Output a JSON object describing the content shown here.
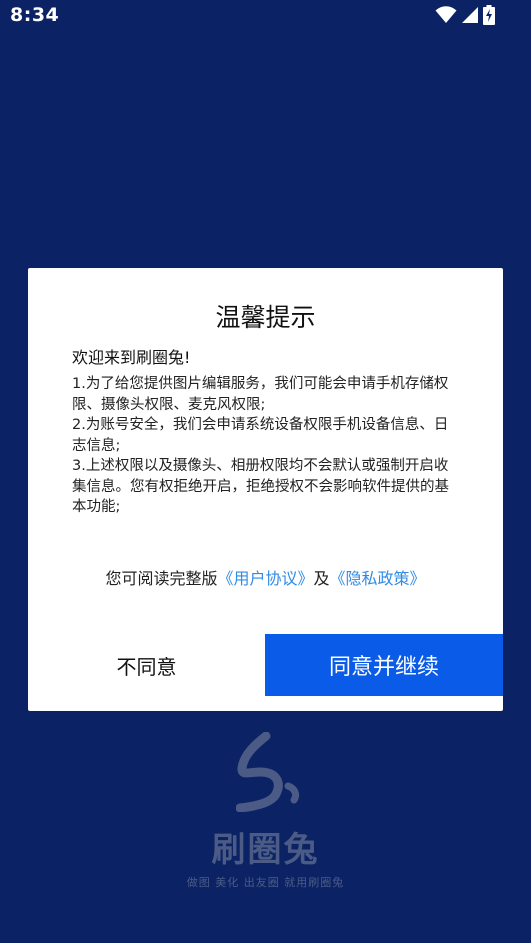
{
  "status_bar": {
    "time": "8:34",
    "icons": [
      "wifi-icon",
      "signal-icon",
      "battery-charging-icon"
    ]
  },
  "dialog": {
    "title": "温馨提示",
    "greeting": "欢迎来到刷圈兔!",
    "paragraphs": [
      "1.为了给您提供图片编辑服务，我们可能会申请手机存储权限、摄像头权限、麦克风权限;",
      "2.为账号安全，我们会申请系统设备权限手机设备信息、日志信息;",
      "3.上述权限以及摄像头、相册权限均不会默认或强制开启收集信息。您有权拒绝开启，拒绝授权不会影响软件提供的基本功能;"
    ],
    "policy": {
      "prefix": "您可阅读完整版",
      "user_agreement": "《用户协议》",
      "conjunction": "及",
      "privacy_policy": "《隐私政策》"
    },
    "buttons": {
      "disagree": "不同意",
      "agree": "同意并继续"
    }
  },
  "brand": {
    "name": "刷圈兔",
    "slogan": "做图 美化 出友圈 就用刷圈兔"
  },
  "colors": {
    "background": "#0b2365",
    "agree_button": "#0a5ce8",
    "link": "#2f8be6",
    "brand_muted": "#4b5b86"
  }
}
